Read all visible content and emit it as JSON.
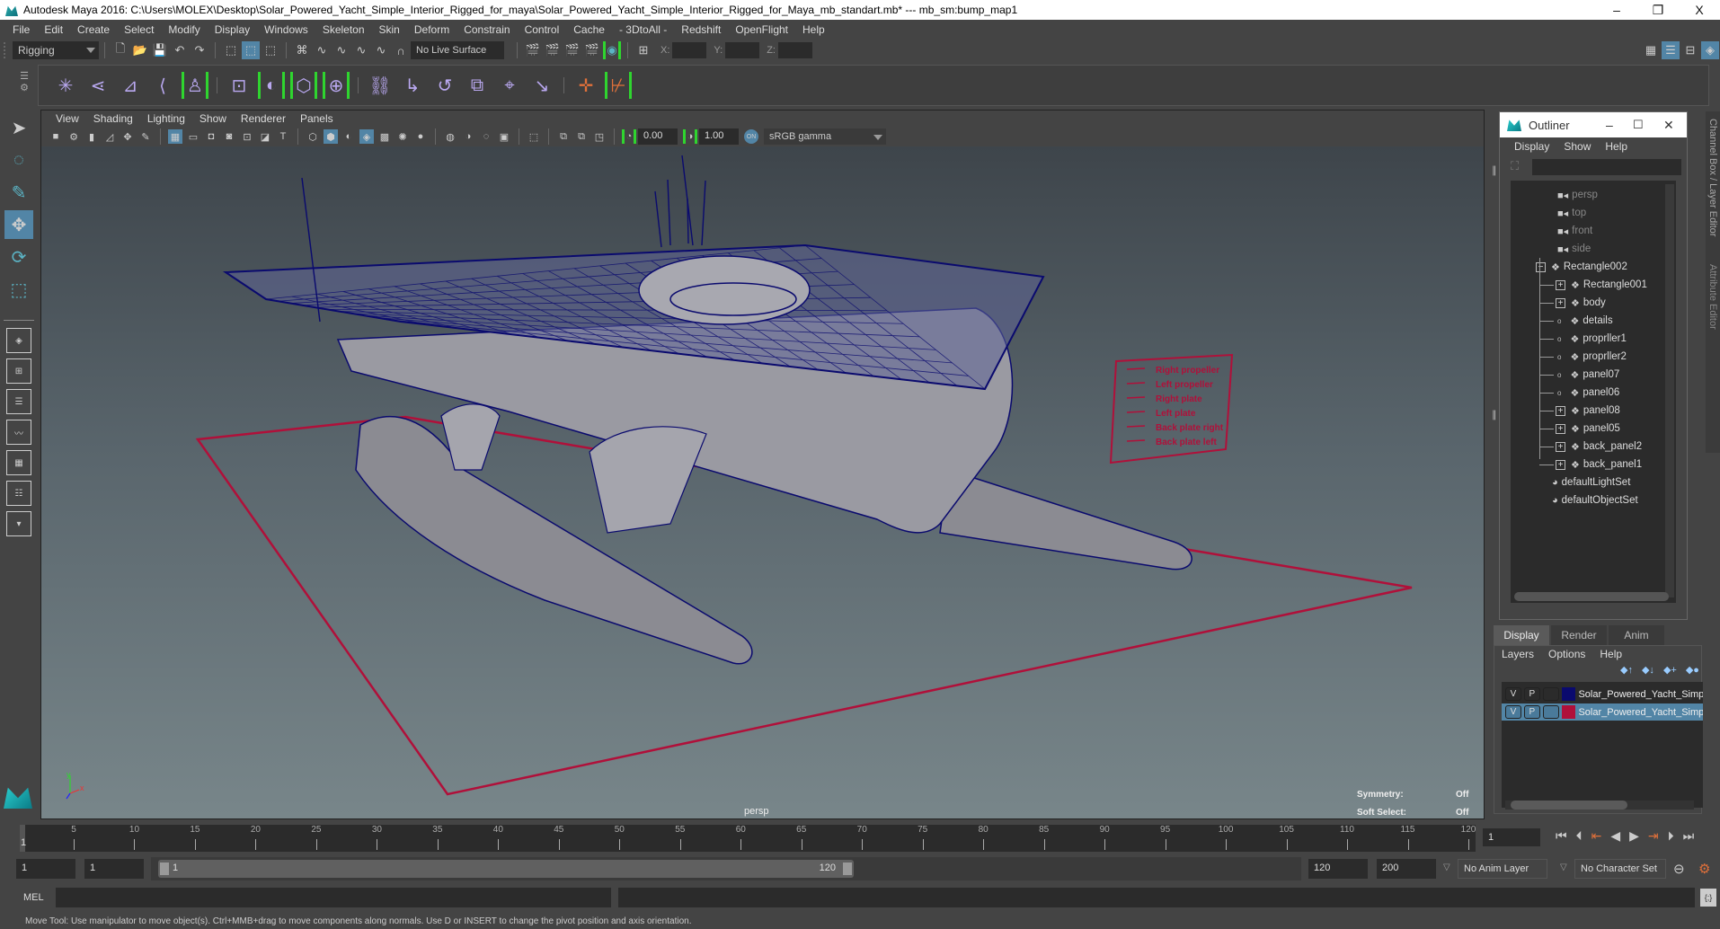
{
  "window": {
    "title": "Autodesk Maya 2016: C:\\Users\\MOLEX\\Desktop\\Solar_Powered_Yacht_Simple_Interior_Rigged_for_maya\\Solar_Powered_Yacht_Simple_Interior_Rigged_for_Maya_mb_standart.mb*  ---  mb_sm:bump_map1",
    "minimize": "–",
    "restore": "❐",
    "close": "X"
  },
  "menubar": [
    "File",
    "Edit",
    "Create",
    "Select",
    "Modify",
    "Display",
    "Windows",
    "Skeleton",
    "Skin",
    "Deform",
    "Constrain",
    "Control",
    "Cache",
    "- 3DtoAll -",
    "Redshift",
    "OpenFlight",
    "Help"
  ],
  "statusline": {
    "menuset": "Rigging",
    "live_surface": "No Live Surface",
    "x_label": "X:",
    "y_label": "Y:",
    "z_label": "Z:"
  },
  "viewport": {
    "menu": [
      "View",
      "Shading",
      "Lighting",
      "Show",
      "Renderer",
      "Panels"
    ],
    "exposure": "0.00",
    "gamma": "1.00",
    "colorspace": "sRGB gamma",
    "camera": "persp",
    "symmetry_label": "Symmetry:",
    "symmetry_value": "Off",
    "soft_select_label": "Soft Select:",
    "soft_select_value": "Off",
    "legend": [
      "Right propeller",
      "Left propeller",
      "Right plate",
      "Left plate",
      "Back plate right",
      "Back plate left"
    ],
    "axis": {
      "y": "y",
      "x": "x",
      "z": "z"
    }
  },
  "outliner": {
    "title": "Outliner",
    "menu": [
      "Display",
      "Show",
      "Help"
    ],
    "items": [
      {
        "label": "persp",
        "type": "camera",
        "dim": true,
        "indent": 0,
        "exp": ""
      },
      {
        "label": "top",
        "type": "camera",
        "dim": true,
        "indent": 0,
        "exp": ""
      },
      {
        "label": "front",
        "type": "camera",
        "dim": true,
        "indent": 0,
        "exp": ""
      },
      {
        "label": "side",
        "type": "camera",
        "dim": true,
        "indent": 0,
        "exp": ""
      },
      {
        "label": "Rectangle002",
        "type": "mesh",
        "dim": false,
        "indent": 0,
        "exp": "−"
      },
      {
        "label": "Rectangle001",
        "type": "mesh",
        "dim": false,
        "indent": 1,
        "exp": "+"
      },
      {
        "label": "body",
        "type": "mesh",
        "dim": false,
        "indent": 1,
        "exp": "+"
      },
      {
        "label": "details",
        "type": "mesh",
        "dim": false,
        "indent": 1,
        "exp": "o"
      },
      {
        "label": "proprller1",
        "type": "mesh",
        "dim": false,
        "indent": 1,
        "exp": "o"
      },
      {
        "label": "proprller2",
        "type": "mesh",
        "dim": false,
        "indent": 1,
        "exp": "o"
      },
      {
        "label": "panel07",
        "type": "mesh",
        "dim": false,
        "indent": 1,
        "exp": "o"
      },
      {
        "label": "panel06",
        "type": "mesh",
        "dim": false,
        "indent": 1,
        "exp": "o"
      },
      {
        "label": "panel08",
        "type": "mesh",
        "dim": false,
        "indent": 1,
        "exp": "+"
      },
      {
        "label": "panel05",
        "type": "mesh",
        "dim": false,
        "indent": 1,
        "exp": "+"
      },
      {
        "label": "back_panel2",
        "type": "mesh",
        "dim": false,
        "indent": 1,
        "exp": "+"
      },
      {
        "label": "back_panel1",
        "type": "mesh",
        "dim": false,
        "indent": 1,
        "exp": "+"
      },
      {
        "label": "defaultLightSet",
        "type": "set",
        "dim": false,
        "indent": 0,
        "exp": ""
      },
      {
        "label": "defaultObjectSet",
        "type": "set",
        "dim": false,
        "indent": 0,
        "exp": ""
      }
    ]
  },
  "side_tabs": [
    "Channel Box / Layer Editor",
    "Attribute Editor"
  ],
  "layer_editor": {
    "tabs": [
      "Display",
      "Render",
      "Anim"
    ],
    "menu": [
      "Layers",
      "Options",
      "Help"
    ],
    "layers": [
      {
        "v": "V",
        "p": "P",
        "color": "#0a0a6e",
        "name": "Solar_Powered_Yacht_Simp",
        "selected": false
      },
      {
        "v": "V",
        "p": "P",
        "color": "#b0103a",
        "name": "Solar_Powered_Yacht_Simp",
        "selected": true
      }
    ]
  },
  "timeline": {
    "ticks": [
      "5",
      "10",
      "15",
      "20",
      "25",
      "30",
      "35",
      "40",
      "45",
      "50",
      "55",
      "60",
      "65",
      "70",
      "75",
      "80",
      "85",
      "90",
      "95",
      "100",
      "105",
      "110",
      "115",
      "120"
    ],
    "start_marker": "1",
    "current_frame": "1"
  },
  "range": {
    "start": "1",
    "playback_start": "1",
    "slider_start": "1",
    "slider_end": "120",
    "playback_end": "120",
    "end": "200",
    "anim_layer": "No Anim Layer",
    "character_set": "No Character Set"
  },
  "command_line": {
    "label": "MEL"
  },
  "help_line": "Move Tool: Use manipulator to move object(s). Ctrl+MMB+drag to move components along normals. Use D or INSERT to change the pivot position and axis orientation.",
  "colors": {
    "accent": "#5285a6",
    "wire": "#0a0a6e",
    "grid_red": "#b0103a",
    "green_bracket": "#2fd52f"
  }
}
